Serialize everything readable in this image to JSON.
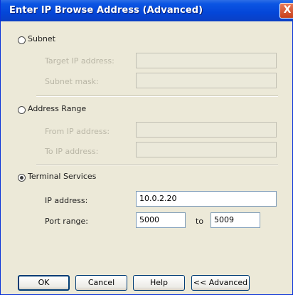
{
  "window": {
    "title": "Enter IP Browse Address (Advanced)",
    "close_symbol": "X"
  },
  "subnet": {
    "label": "Subnet",
    "selected": false,
    "target_address_label": "Target IP address:",
    "target_address_value": "",
    "subnet_mask_label": "Subnet mask:",
    "subnet_mask_value": ""
  },
  "address_range": {
    "label": "Address Range",
    "selected": false,
    "from_label": "From IP address:",
    "from_value": "",
    "to_label": "To IP address:",
    "to_value": ""
  },
  "terminal_services": {
    "label": "Terminal Services",
    "selected": true,
    "ip_label": "IP address:",
    "ip_value": "10.0.2.20",
    "port_label": "Port range:",
    "port_from": "5000",
    "port_to_word": "to",
    "port_to": "5009"
  },
  "buttons": {
    "ok": "OK",
    "cancel": "Cancel",
    "help": "Help",
    "advanced": "<< Advanced"
  }
}
